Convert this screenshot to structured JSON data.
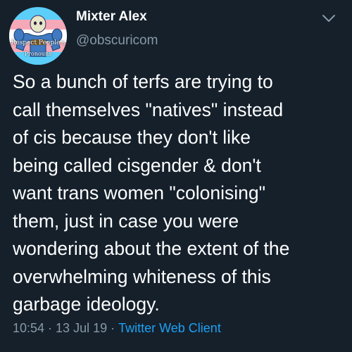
{
  "author": {
    "display_name": "Mixter Alex",
    "handle": "@obscuricom",
    "avatar": {
      "text_line1": "Respect People's",
      "text_line2": "Pronouns",
      "flag_colors": [
        "#5bcefa",
        "#f5a9b8",
        "#ffffff"
      ]
    }
  },
  "tweet": {
    "text": "So a bunch of terfs are trying to\ncall themselves \"natives\" instead\nof cis because they don't like\nbeing called cisgender & don't\nwant trans women \"colonising\"\nthem, just in case you were\nwondering about the extent of the\noverwhelming whiteness of this\ngarbage ideology.",
    "time": "10:54",
    "separator": "·",
    "date": "13 Jul 19",
    "client": "Twitter Web Client"
  },
  "menu": {
    "icon": "chevron-down-icon"
  },
  "colors": {
    "background": "#15202b",
    "primary_text": "#ffffff",
    "secondary_text": "#8899a6",
    "link": "#1da1f2"
  }
}
